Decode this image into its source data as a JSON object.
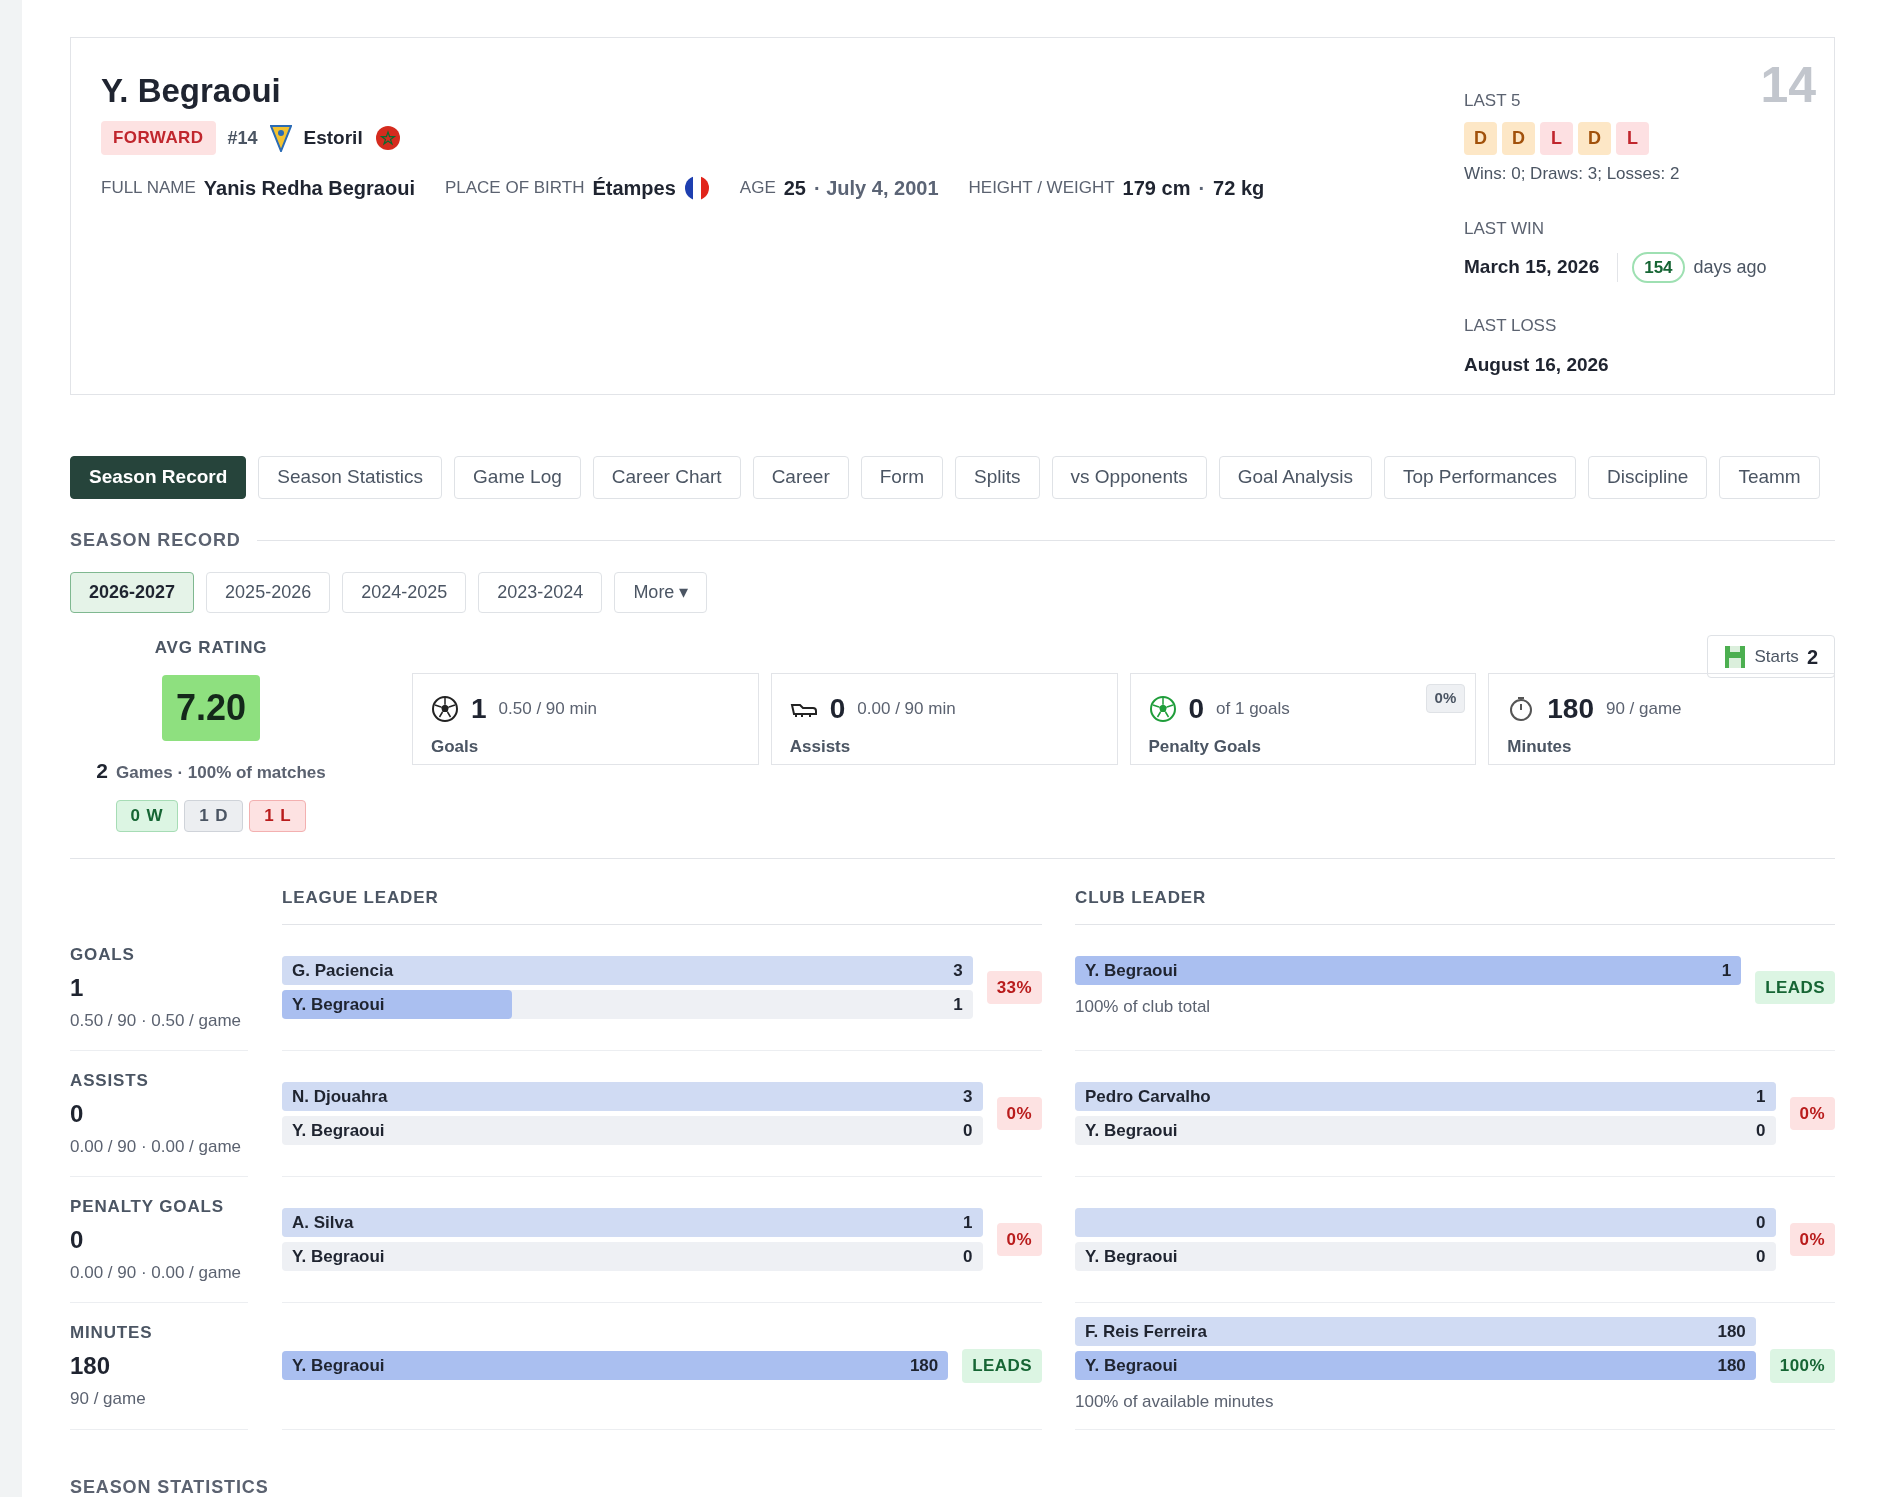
{
  "player": {
    "name": "Y. Begraoui",
    "position": "FORWARD",
    "number": "#14",
    "club": "Estoril",
    "shirt_number": "14",
    "facts": [
      {
        "label": "FULL NAME",
        "value": "Yanis Redha Begraoui"
      },
      {
        "label": "PLACE OF BIRTH",
        "value": "Étampes",
        "kind": "flagged"
      },
      {
        "label": "AGE",
        "value": "25",
        "extra": "· July 4, 2001"
      },
      {
        "label": "HEIGHT / WEIGHT",
        "value": "179 cm",
        "extra": "·",
        "value2": "72 kg"
      }
    ]
  },
  "last5": {
    "label": "LAST 5",
    "results": [
      {
        "result": "D"
      },
      {
        "result": "D"
      },
      {
        "result": "L"
      },
      {
        "result": "D"
      },
      {
        "result": "L"
      }
    ],
    "summary": "Wins: 0; Draws: 3; Losses: 2"
  },
  "last_win": {
    "label": "LAST WIN",
    "date": "March 15, 2026",
    "days": "154",
    "days_suffix": "days ago"
  },
  "last_loss": {
    "label": "LAST LOSS",
    "date": "August 16, 2026"
  },
  "tabs": [
    {
      "label": "Season Record",
      "selected": true
    },
    {
      "label": "Season Statistics",
      "selected": false
    },
    {
      "label": "Game Log",
      "selected": false
    },
    {
      "label": "Career Chart",
      "selected": false
    },
    {
      "label": "Career",
      "selected": false
    },
    {
      "label": "Form",
      "selected": false
    },
    {
      "label": "Splits",
      "selected": false
    },
    {
      "label": "vs Opponents",
      "selected": false
    },
    {
      "label": "Goal Analysis",
      "selected": false
    },
    {
      "label": "Top Performances",
      "selected": false
    },
    {
      "label": "Discipline",
      "selected": false
    },
    {
      "label": "Teamm",
      "selected": false
    }
  ],
  "section_title": "SEASON RECORD",
  "seasons": [
    {
      "label": "2026-2027",
      "selected": true
    },
    {
      "label": "2025-2026",
      "selected": false
    },
    {
      "label": "2024-2025",
      "selected": false
    },
    {
      "label": "2023-2024",
      "selected": false
    }
  ],
  "more_button": "More ▾",
  "rating": {
    "label": "AVG RATING",
    "value": "7.20",
    "games": "2",
    "games_text": "Games · 100% of matches",
    "record": [
      {
        "kind": "win",
        "text": "0 W"
      },
      {
        "kind": "draw",
        "text": "1 D"
      },
      {
        "kind": "loss",
        "text": "1 L"
      }
    ]
  },
  "starts": {
    "label": "Starts",
    "value": "2"
  },
  "stat_cards": [
    {
      "kind": "ball",
      "value": "1",
      "sub": "0.50 / 90 min",
      "label": "Goals"
    },
    {
      "kind": "boot",
      "value": "0",
      "sub": "0.00 / 90 min",
      "label": "Assists"
    },
    {
      "kind": "penalty",
      "value": "0",
      "sub": "of 1 goals",
      "label": "Penalty Goals",
      "badge": "0%"
    },
    {
      "kind": "stopwatch",
      "value": "180",
      "sub": "90 / game",
      "label": "Minutes"
    }
  ],
  "leader_headers": {
    "league": "LEAGUE LEADER",
    "club": "CLUB LEADER"
  },
  "leader_rows": [
    {
      "label": "GOALS",
      "value": "1",
      "sub": "0.50 / 90 · 0.50 / game",
      "league": {
        "bars": [
          {
            "name": "G. Paciencia",
            "value": "3",
            "level": 1,
            "self": false
          },
          {
            "name": "Y. Begraoui",
            "value": "1",
            "level": 0.333,
            "self": true
          }
        ],
        "badge": "33%",
        "kind": "behind"
      },
      "club": {
        "bars": [
          {
            "name": "Y. Begraoui",
            "value": "1",
            "level": 1,
            "self": true
          }
        ],
        "note": "100% of club total",
        "badge": "LEADS",
        "kind": "lead"
      }
    },
    {
      "label": "ASSISTS",
      "value": "0",
      "sub": "0.00 / 90 · 0.00 / game",
      "league": {
        "bars": [
          {
            "name": "N. Djouahra",
            "value": "3",
            "level": 1,
            "self": false
          },
          {
            "name": "Y. Begraoui",
            "value": "0",
            "level": 0
          }
        ],
        "badge": "0%",
        "kind": "behind"
      },
      "club": {
        "bars": [
          {
            "name": "Pedro Carvalho",
            "value": "1",
            "level": 1,
            "self": false
          },
          {
            "name": "Y. Begraoui",
            "value": "0",
            "level": 0
          }
        ],
        "badge": "0%",
        "kind": "behind"
      }
    },
    {
      "label": "PENALTY GOALS",
      "value": "0",
      "sub": "0.00 / 90 · 0.00 / game",
      "league": {
        "bars": [
          {
            "name": "A. Silva",
            "value": "1",
            "level": 1,
            "self": false
          },
          {
            "name": "Y. Begraoui",
            "value": "0",
            "level": 0
          }
        ],
        "badge": "0%",
        "kind": "behind"
      },
      "club": {
        "bars": [
          {
            "value": "0",
            "level": 1,
            "self": false
          },
          {
            "name": "Y. Begraoui",
            "value": "0",
            "level": 0
          }
        ],
        "badge": "0%",
        "kind": "behind"
      }
    },
    {
      "label": "MINUTES",
      "value": "180",
      "sub": "90 / game",
      "league": {
        "bars": [
          {
            "name": "Y. Begraoui",
            "value": "180",
            "level": 1,
            "self": true
          }
        ],
        "badge": "LEADS",
        "kind": "lead"
      },
      "club": {
        "bars": [
          {
            "name": "F. Reis Ferreira",
            "value": "180",
            "level": 1,
            "self": false
          },
          {
            "name": "Y. Begraoui",
            "value": "180",
            "level": 1,
            "self": true
          }
        ],
        "note": "100% of available minutes",
        "badge": "100%",
        "kind": "lead"
      }
    }
  ],
  "next_section_title": "SEASON STATISTICS"
}
